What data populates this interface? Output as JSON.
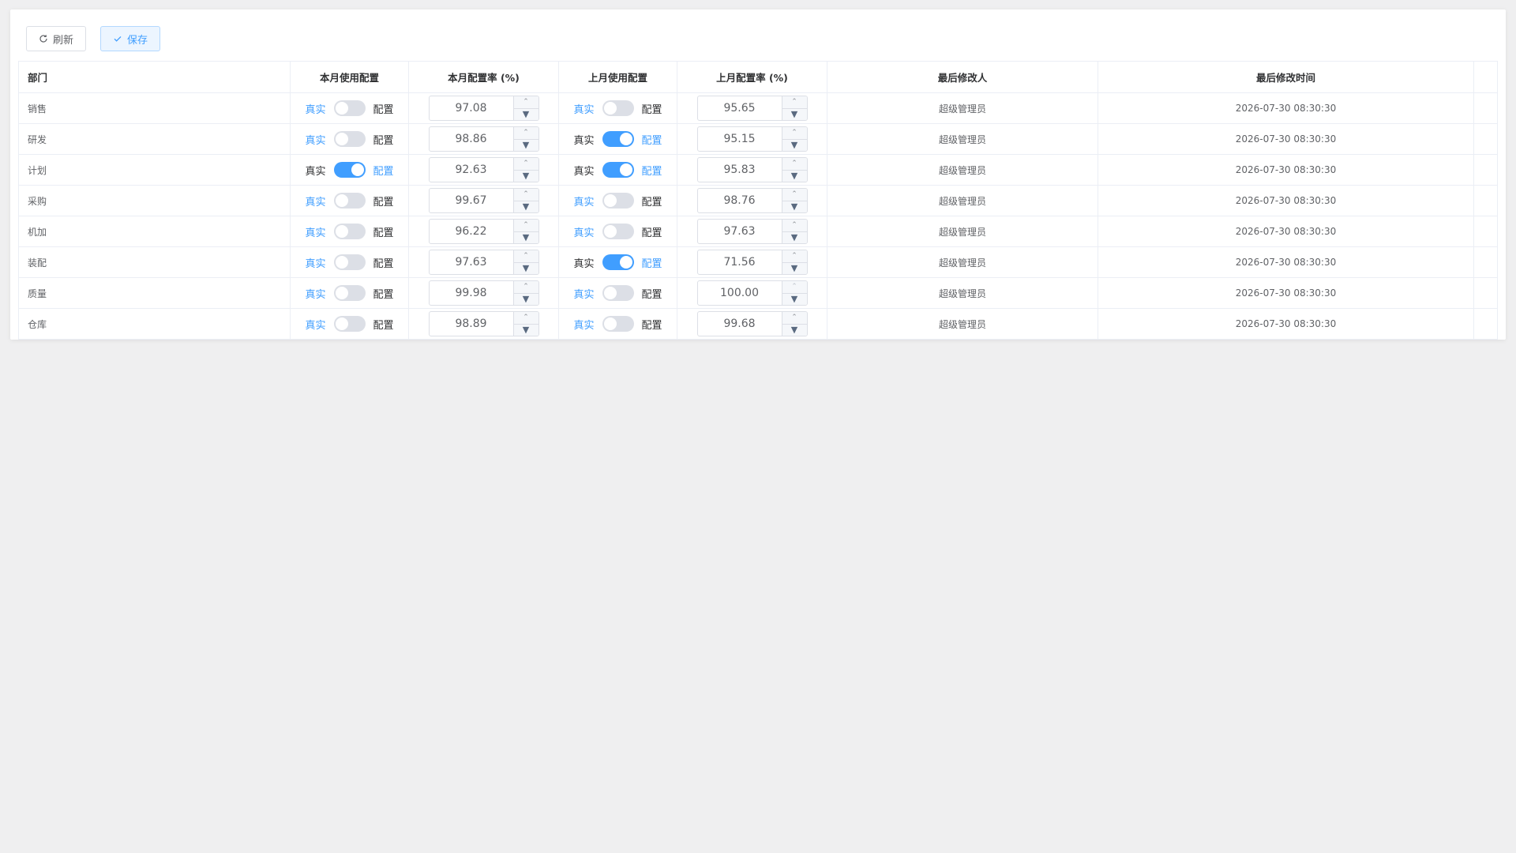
{
  "toolbar": {
    "refresh_label": "刷新",
    "save_label": "保存"
  },
  "columns": [
    "部门",
    "本月使用配置",
    "本月配置率 (%)",
    "上月使用配置",
    "上月配置率 (%)",
    "最后修改人",
    "最后修改时间"
  ],
  "switch_labels": {
    "left": "真实",
    "right": "配置"
  },
  "rows": [
    {
      "dept": "销售",
      "cur_on": false,
      "cur_rate": "97.08",
      "last_on": false,
      "last_rate": "95.65",
      "modifier": "超级管理员",
      "time": "2026-07-30 08:30:30"
    },
    {
      "dept": "研发",
      "cur_on": false,
      "cur_rate": "98.86",
      "last_on": true,
      "last_rate": "95.15",
      "modifier": "超级管理员",
      "time": "2026-07-30 08:30:30"
    },
    {
      "dept": "计划",
      "cur_on": true,
      "cur_rate": "92.63",
      "last_on": true,
      "last_rate": "95.83",
      "modifier": "超级管理员",
      "time": "2026-07-30 08:30:30"
    },
    {
      "dept": "采购",
      "cur_on": false,
      "cur_rate": "99.67",
      "last_on": false,
      "last_rate": "98.76",
      "modifier": "超级管理员",
      "time": "2026-07-30 08:30:30"
    },
    {
      "dept": "机加",
      "cur_on": false,
      "cur_rate": "96.22",
      "last_on": false,
      "last_rate": "97.63",
      "modifier": "超级管理员",
      "time": "2026-07-30 08:30:30"
    },
    {
      "dept": "装配",
      "cur_on": false,
      "cur_rate": "97.63",
      "last_on": true,
      "last_rate": "71.56",
      "modifier": "超级管理员",
      "time": "2026-07-30 08:30:30"
    },
    {
      "dept": "质量",
      "cur_on": false,
      "cur_rate": "99.98",
      "last_on": false,
      "last_rate": "100.00",
      "modifier": "超级管理员",
      "time": "2026-07-30 08:30:30"
    },
    {
      "dept": "仓库",
      "cur_on": false,
      "cur_rate": "98.89",
      "last_on": false,
      "last_rate": "99.68",
      "modifier": "超级管理员",
      "time": "2026-07-30 08:30:30"
    }
  ],
  "colors": {
    "primary": "#409eff",
    "border": "#ebeef5",
    "switch_off": "#dcdfe6"
  }
}
